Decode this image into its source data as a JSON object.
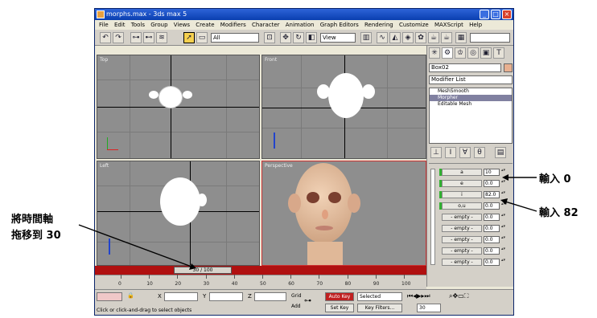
{
  "window": {
    "title": "morphs.max - 3ds max 5"
  },
  "menu": [
    "File",
    "Edit",
    "Tools",
    "Group",
    "Views",
    "Create",
    "Modifiers",
    "Character",
    "Animation",
    "Graph Editors",
    "Rendering",
    "Customize",
    "MAXScript",
    "Help"
  ],
  "toolbar": {
    "selection_filter": "All",
    "ref_coord": "View"
  },
  "viewports": {
    "top": "Top",
    "front": "Front",
    "left": "Left",
    "perspective": "Perspective"
  },
  "panel": {
    "object_name": "Box02",
    "modifier_list": "Modifier List",
    "stack": [
      "MeshSmooth",
      "Morpher",
      "Editable Mesh"
    ],
    "channels": [
      {
        "label": "a",
        "value": "10"
      },
      {
        "label": "e",
        "value": "0.0"
      },
      {
        "label": "i",
        "value": "82.0"
      },
      {
        "label": "o,u",
        "value": "0.0"
      },
      {
        "label": "- empty -",
        "value": "0.0"
      },
      {
        "label": "- empty -",
        "value": "0.0"
      },
      {
        "label": "- empty -",
        "value": "0.0"
      },
      {
        "label": "- empty -",
        "value": "0.0"
      },
      {
        "label": "- empty -",
        "value": "0.0"
      }
    ]
  },
  "timeline": {
    "slider_label": "30 / 100",
    "ticks": [
      "0",
      "10",
      "20",
      "30",
      "40",
      "50",
      "60",
      "70",
      "80",
      "90",
      "100"
    ]
  },
  "status": {
    "prompt": "Click or click-and-drag to select objects",
    "x_label": "X",
    "y_label": "Y",
    "z_label": "Z",
    "grid_label": "Grid",
    "add_label": "Add",
    "autokey": "Auto Key",
    "set_key": "Set Key",
    "key_filters": "Key Filters...",
    "selected": "Selected",
    "frame": "30"
  },
  "callouts": {
    "input0": "輸入 0",
    "input82": "輸入 82",
    "timeline_line1": "將時間軸",
    "timeline_line2": "拖移到 30"
  }
}
